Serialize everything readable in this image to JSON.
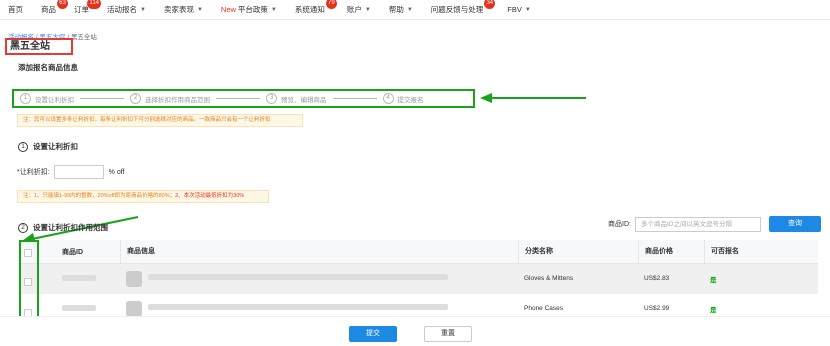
{
  "nav": {
    "items": [
      {
        "label": "首页",
        "badge": "",
        "caret": false
      },
      {
        "label": "商品",
        "badge": "63",
        "caret": false
      },
      {
        "label": "订单",
        "badge": "114",
        "caret": false
      },
      {
        "label": "活动报名",
        "badge": "",
        "caret": true
      },
      {
        "label": "卖家表现",
        "badge": "",
        "caret": true
      },
      {
        "label": "平台政策",
        "prefix": "New",
        "badge": "",
        "caret": true
      },
      {
        "label": "系统通知",
        "badge": "79",
        "caret": false
      },
      {
        "label": "账户",
        "badge": "",
        "caret": true
      },
      {
        "label": "帮助",
        "badge": "",
        "caret": true
      },
      {
        "label": "问题反馈与处理",
        "badge": "34",
        "caret": false
      },
      {
        "label": "FBV",
        "badge": "",
        "caret": true
      }
    ]
  },
  "breadcrumb": {
    "part1": "活动报名",
    "sep1": " / ",
    "part2": "黑五大促",
    "sep2": " / ",
    "current": "黑五全站"
  },
  "page": {
    "title": "黑五全站",
    "section_title": "添加报名商品信息"
  },
  "steps": [
    {
      "num": "1",
      "label": "设置让利折扣"
    },
    {
      "num": "2",
      "label": "选择折扣作用商品范围"
    },
    {
      "num": "3",
      "label": "预览、编辑商品"
    },
    {
      "num": "4",
      "label": "提交报名"
    }
  ],
  "notice1": "注：您可以设置多条让利折扣，每条让利折扣下可分别选择对应的商品。一款商品只会有一个让利折扣",
  "section1": {
    "num": "1",
    "title": "设置让利折扣"
  },
  "discount": {
    "label": "*让利折扣:",
    "unit": "% off"
  },
  "notice2": {
    "text": "注：1、只能填1-99内的整数，20%off即为原商品价格的80%；",
    "warn": "2、本次活动最低折扣为30%"
  },
  "section2": {
    "num": "2",
    "title": "设置让利折扣作用范围"
  },
  "search": {
    "label": "商品ID:",
    "placeholder": "多个商品ID之间以英文逗号分隔",
    "button": "查询"
  },
  "table": {
    "headers": {
      "id": "商品ID",
      "info": "商品信息",
      "category": "分类名称",
      "price": "商品价格",
      "eligible": "可否报名"
    },
    "rows": [
      {
        "category": "Gloves & Mittens",
        "price": "US$2.83",
        "eligible": "是"
      },
      {
        "category": "Phone Cases",
        "price": "US$2.99",
        "eligible": "是"
      }
    ]
  },
  "actions": {
    "submit": "提交",
    "reset": "重置"
  },
  "colors": {
    "accent": "#1e88e5",
    "highlight_red": "#e53935",
    "highlight_green": "#1aa31a",
    "badge": "#e8311a"
  }
}
